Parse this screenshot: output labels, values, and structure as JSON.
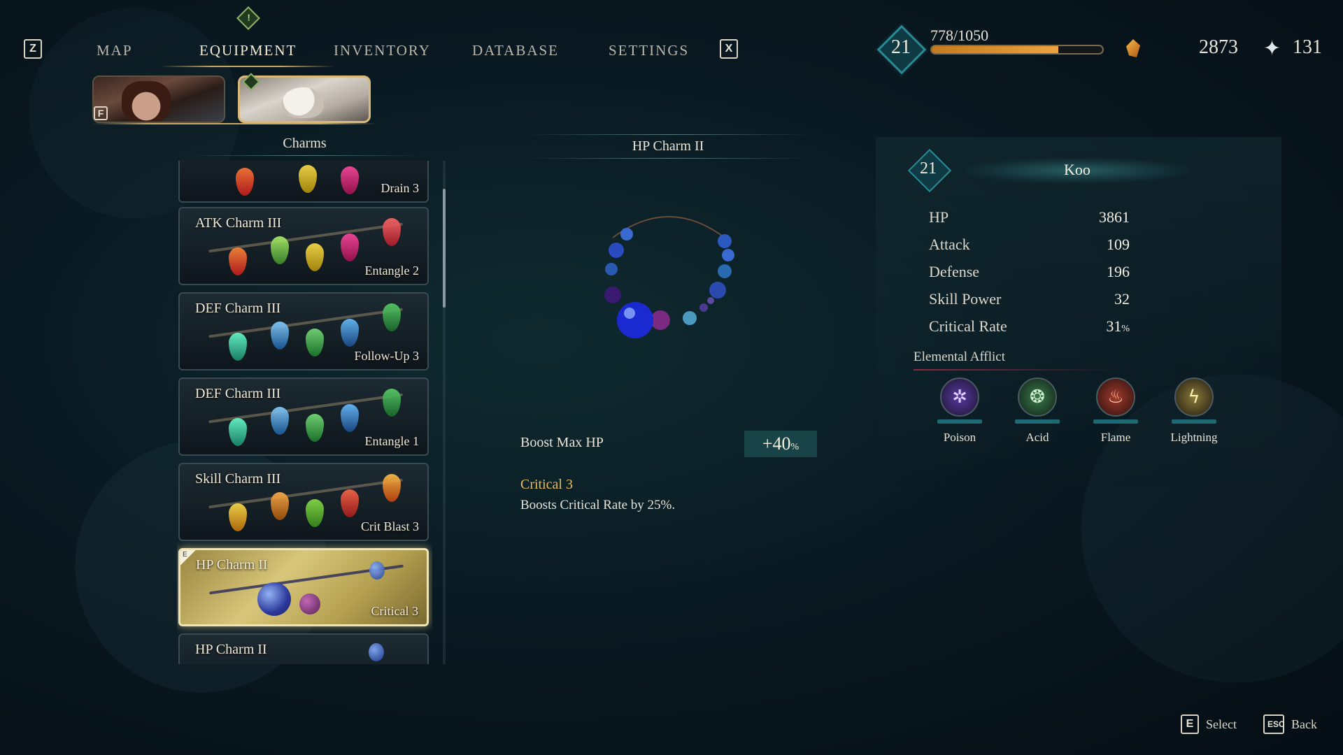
{
  "nav": {
    "left_key": "Z",
    "right_key": "X",
    "tabs": [
      "MAP",
      "EQUIPMENT",
      "INVENTORY",
      "DATABASE",
      "SETTINGS"
    ],
    "alert_glyph": "!"
  },
  "player": {
    "level": "21",
    "xp_text": "778/1050",
    "xp_progress": 0.741,
    "currency_amount": "2873",
    "currency2_amount": "131",
    "icons": {
      "currency": "amber-crystal-icon",
      "currency2": "spark-icon"
    }
  },
  "portraits": {
    "switch_key": "F",
    "icons": [
      "character-portrait-icon",
      "wolf-portrait-icon"
    ]
  },
  "charms": {
    "header": "Charms",
    "items": [
      {
        "name": "",
        "sub": "Drain 3"
      },
      {
        "name": "ATK Charm III",
        "sub": "Entangle 2"
      },
      {
        "name": "DEF Charm III",
        "sub": "Follow-Up 3"
      },
      {
        "name": "DEF Charm III",
        "sub": "Entangle 1"
      },
      {
        "name": "Skill Charm III",
        "sub": "Crit Blast 3"
      },
      {
        "name": "HP Charm II",
        "sub": "Critical 3",
        "equipped_mark": "E"
      },
      {
        "name": "HP Charm II",
        "sub": ""
      }
    ]
  },
  "detail": {
    "title": "HP Charm II",
    "effect_label": "Boost Max HP",
    "effect_value": "+40",
    "effect_unit": "%",
    "skill_name": "Critical 3",
    "skill_desc": "Boosts Critical Rate by 25%."
  },
  "character": {
    "level": "21",
    "name": "Koo",
    "stats": [
      {
        "label": "HP",
        "value": "3861",
        "unit": ""
      },
      {
        "label": "Attack",
        "value": "109",
        "unit": ""
      },
      {
        "label": "Defense",
        "value": "196",
        "unit": ""
      },
      {
        "label": "Skill Power",
        "value": "32",
        "unit": ""
      },
      {
        "label": "Critical Rate",
        "value": "31",
        "unit": "%"
      }
    ],
    "elemental_title": "Elemental Afflict",
    "elements": [
      {
        "label": "Poison",
        "icon": "poison-icon",
        "color": "#8a5ad0"
      },
      {
        "label": "Acid",
        "icon": "acid-icon",
        "color": "#5aa070"
      },
      {
        "label": "Flame",
        "icon": "flame-icon",
        "color": "#d05a3a"
      },
      {
        "label": "Lightning",
        "icon": "lightning-icon",
        "color": "#d0b04a"
      }
    ]
  },
  "controls": {
    "select_key": "E",
    "select_label": "Select",
    "back_key": "ESC",
    "back_label": "Back"
  },
  "colors": {
    "accent_gold": "#c9a760",
    "teal": "#2a8a94",
    "skill_gold": "#e6bd62"
  }
}
